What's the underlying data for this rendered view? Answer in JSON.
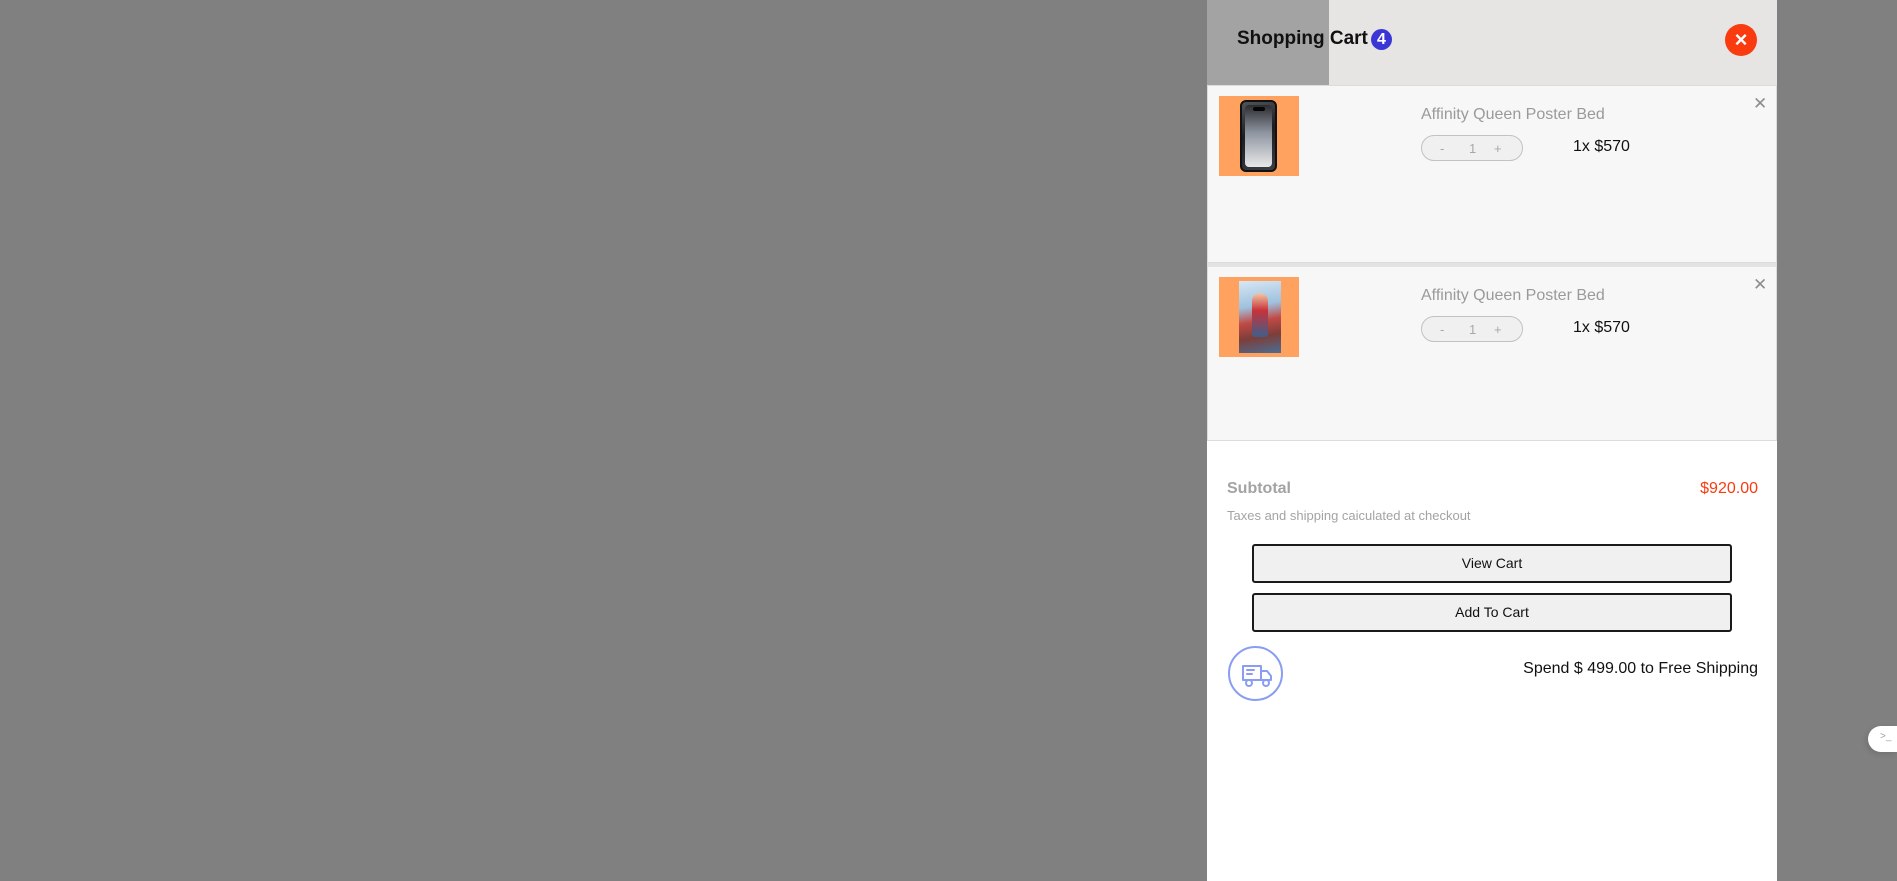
{
  "cart": {
    "title": "Shopping Cart",
    "count": "4",
    "close_glyph": "×"
  },
  "items": [
    {
      "name": "Affinity Queen Poster Bed",
      "qty_minus": "-",
      "qty_value": "1",
      "qty_plus": "+",
      "price": "1x $570",
      "remove_glyph": "✕",
      "image": "smartphone-thumbnail"
    },
    {
      "name": "Affinity Queen Poster Bed",
      "qty_minus": "-",
      "qty_value": "1",
      "qty_plus": "+",
      "price": "1x $570",
      "remove_glyph": "✕",
      "image": "poster-thumbnail"
    }
  ],
  "summary": {
    "subtotal_label": "Subtotal",
    "subtotal_value": "$920.00",
    "tax_note": "Taxes and shipping caiculated at checkout"
  },
  "actions": {
    "view_cart": "View Cart",
    "add_to_cart": "Add To Cart"
  },
  "shipping": {
    "message": "Spend $ 499.00 to Free Shipping",
    "icon": "delivery-truck-icon"
  },
  "colors": {
    "accent": "#fa3b0f",
    "badge": "#3b35d6",
    "thumbnail_bg": "#ffa25f",
    "shipping_icon": "#8a9df4"
  }
}
